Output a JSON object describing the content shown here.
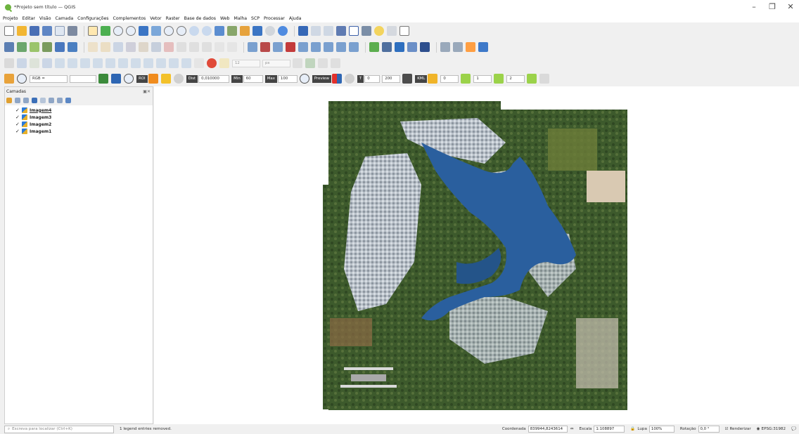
{
  "window": {
    "title": "*Projeto sem título — QGIS",
    "controls": [
      "–",
      "❐",
      "✕"
    ]
  },
  "menu": [
    "Projeto",
    "Editar",
    "Visão",
    "Camada",
    "Configurações",
    "Complementos",
    "Vetor",
    "Raster",
    "Base de dados",
    "Web",
    "Malha",
    "SCP",
    "Processar",
    "Ajuda"
  ],
  "scp_toolbar": {
    "band_set_value": "RGB =",
    "roi_label": "ROI",
    "dist_label": "Dist",
    "dist_value": "0,010000",
    "min_label": "Min",
    "min_value": "60",
    "max_label": "Max",
    "max_value": "100",
    "preview_label": "Preview",
    "t_label": "T",
    "t_value": "0",
    "s_value": "200",
    "kml_label": "KML",
    "n1": "0",
    "n2": "1",
    "n3": "2"
  },
  "digitize_toolbar": {
    "size_value": "12",
    "unit_value": "px"
  },
  "layers_panel": {
    "title": "Camadas",
    "layers": [
      {
        "name": "Imagem4",
        "checked": true,
        "underline": true
      },
      {
        "name": "Imagem3",
        "checked": true
      },
      {
        "name": "Imagem2",
        "checked": true
      },
      {
        "name": "Imagem1",
        "checked": true
      }
    ]
  },
  "statusbar": {
    "search_placeholder": "Escreva para localizar (Ctrl+K)",
    "message": "1 legend entries removed.",
    "coord_label": "Coordenada",
    "coord_value": "839944,8243614",
    "scale_label": "Escala",
    "scale_value": "1:108897",
    "magnifier_label": "Lupa",
    "magnifier_value": "100%",
    "rotation_label": "Rotação",
    "rotation_value": "0,0 °",
    "render_label": "Renderizar",
    "crs_label": "EPSG:31982"
  },
  "colors": {
    "water": "#2a5f9e",
    "vegetation": "#3b5a2a",
    "urban": "#c8cfd6"
  }
}
